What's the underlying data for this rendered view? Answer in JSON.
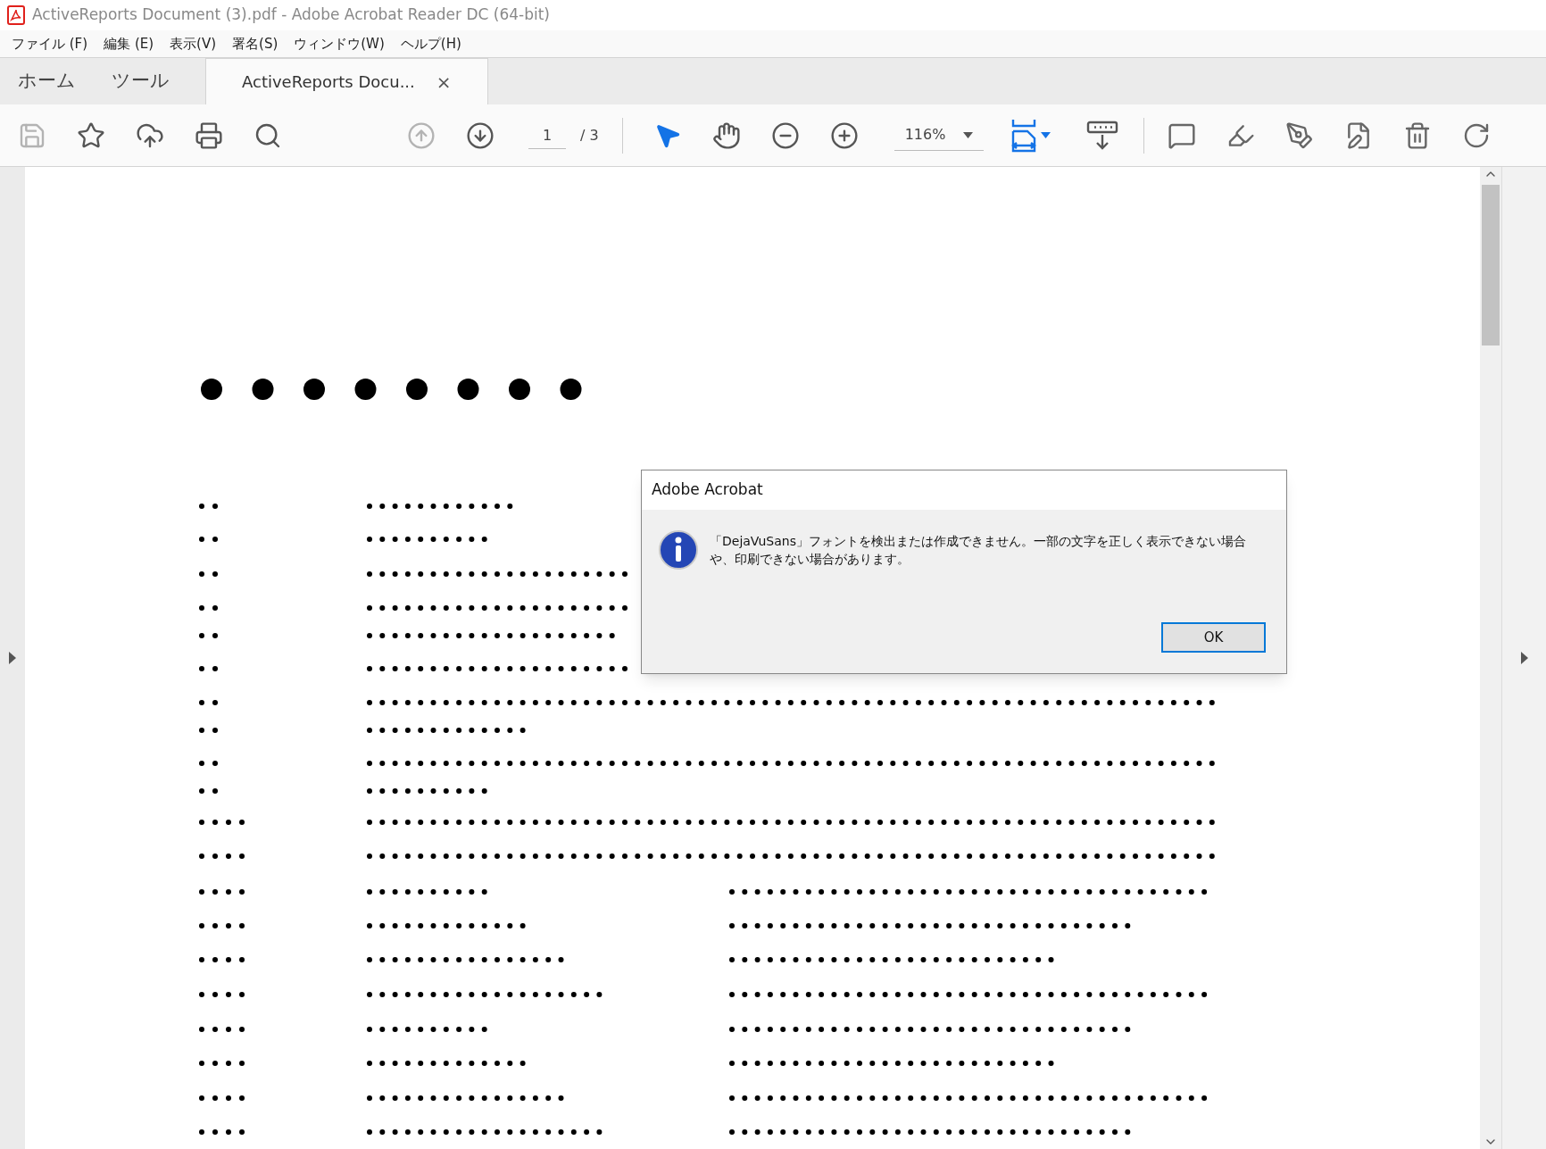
{
  "window": {
    "title": "ActiveReports Document (3).pdf - Adobe Acrobat Reader DC (64-bit)"
  },
  "menu": [
    "ファイル (F)",
    "編集 (E)",
    "表示(V)",
    "署名(S)",
    "ウィンドウ(W)",
    "ヘルプ(H)"
  ],
  "tabs": [
    {
      "label": "ホーム",
      "selected": false,
      "kind": "nav"
    },
    {
      "label": "ツール",
      "selected": false,
      "kind": "nav"
    },
    {
      "label": "ActiveReports Docu...",
      "selected": true,
      "kind": "document",
      "close": "×"
    }
  ],
  "toolbar": {
    "file_tools": [
      {
        "kind": "save",
        "disabled": true
      },
      {
        "kind": "bookmark",
        "disabled": false
      },
      {
        "kind": "upload",
        "disabled": false
      },
      {
        "kind": "print",
        "disabled": false
      },
      {
        "kind": "find",
        "disabled": false
      }
    ],
    "page_nav": [
      {
        "kind": "previous",
        "disabled": true
      },
      {
        "kind": "next",
        "disabled": false
      }
    ],
    "page_current": "1",
    "page_total": "/ 3",
    "pointer_tools": [
      {
        "kind": "select",
        "selected": true
      },
      {
        "kind": "hand",
        "selected": false
      }
    ],
    "zoom_buttons": [
      {
        "kind": "zoom-out"
      },
      {
        "kind": "zoom-in"
      }
    ],
    "zoom": "116%",
    "edit_tools": [
      {
        "kind": "comment"
      },
      {
        "kind": "highlight"
      },
      {
        "kind": "sign"
      },
      {
        "kind": "edit"
      },
      {
        "kind": "delete"
      },
      {
        "kind": "rotate"
      }
    ]
  },
  "dialog": {
    "title": "Adobe Acrobat",
    "message": "「DejaVuSans」フォントを検出または作成できません。一部の文字を正しく表示できない場合や、印刷できない場合があります。",
    "button": "OK"
  }
}
